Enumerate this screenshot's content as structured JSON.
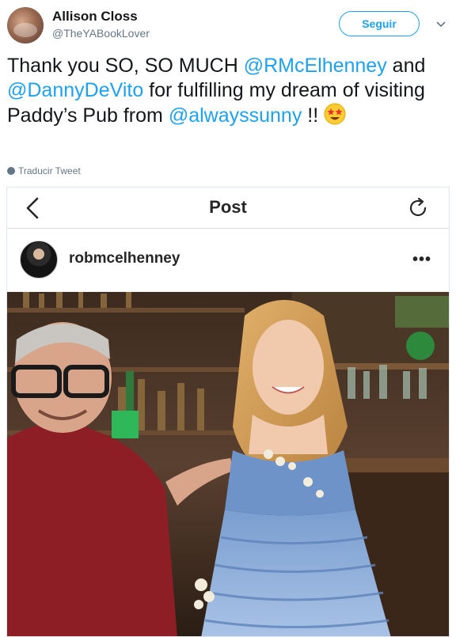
{
  "tweet": {
    "author_name": "Allison Closs",
    "author_handle": "@TheYABookLover",
    "follow_label": "Seguir",
    "text_parts": [
      {
        "type": "text",
        "value": "Thank you SO, SO MUCH "
      },
      {
        "type": "mention",
        "value": "@RMcElhenney"
      },
      {
        "type": "text",
        "value": " and "
      },
      {
        "type": "mention",
        "value": "@DannyDeVito"
      },
      {
        "type": "text",
        "value": " for fulfilling my dream of visiting Paddy’s Pub from "
      },
      {
        "type": "mention",
        "value": "@alwayssunny"
      },
      {
        "type": "text",
        "value": " !! "
      }
    ],
    "translate_label": "Traducir Tweet"
  },
  "instagram": {
    "header_title": "Post",
    "username": "robmcelhenney",
    "more_label": "•••"
  },
  "colors": {
    "accent": "#1da1f2",
    "secondary_text": "#657786"
  },
  "icons": {
    "emoji": "star-struck-emoji",
    "back": "chevron-left-icon",
    "refresh": "refresh-icon",
    "more": "more-options-icon"
  }
}
